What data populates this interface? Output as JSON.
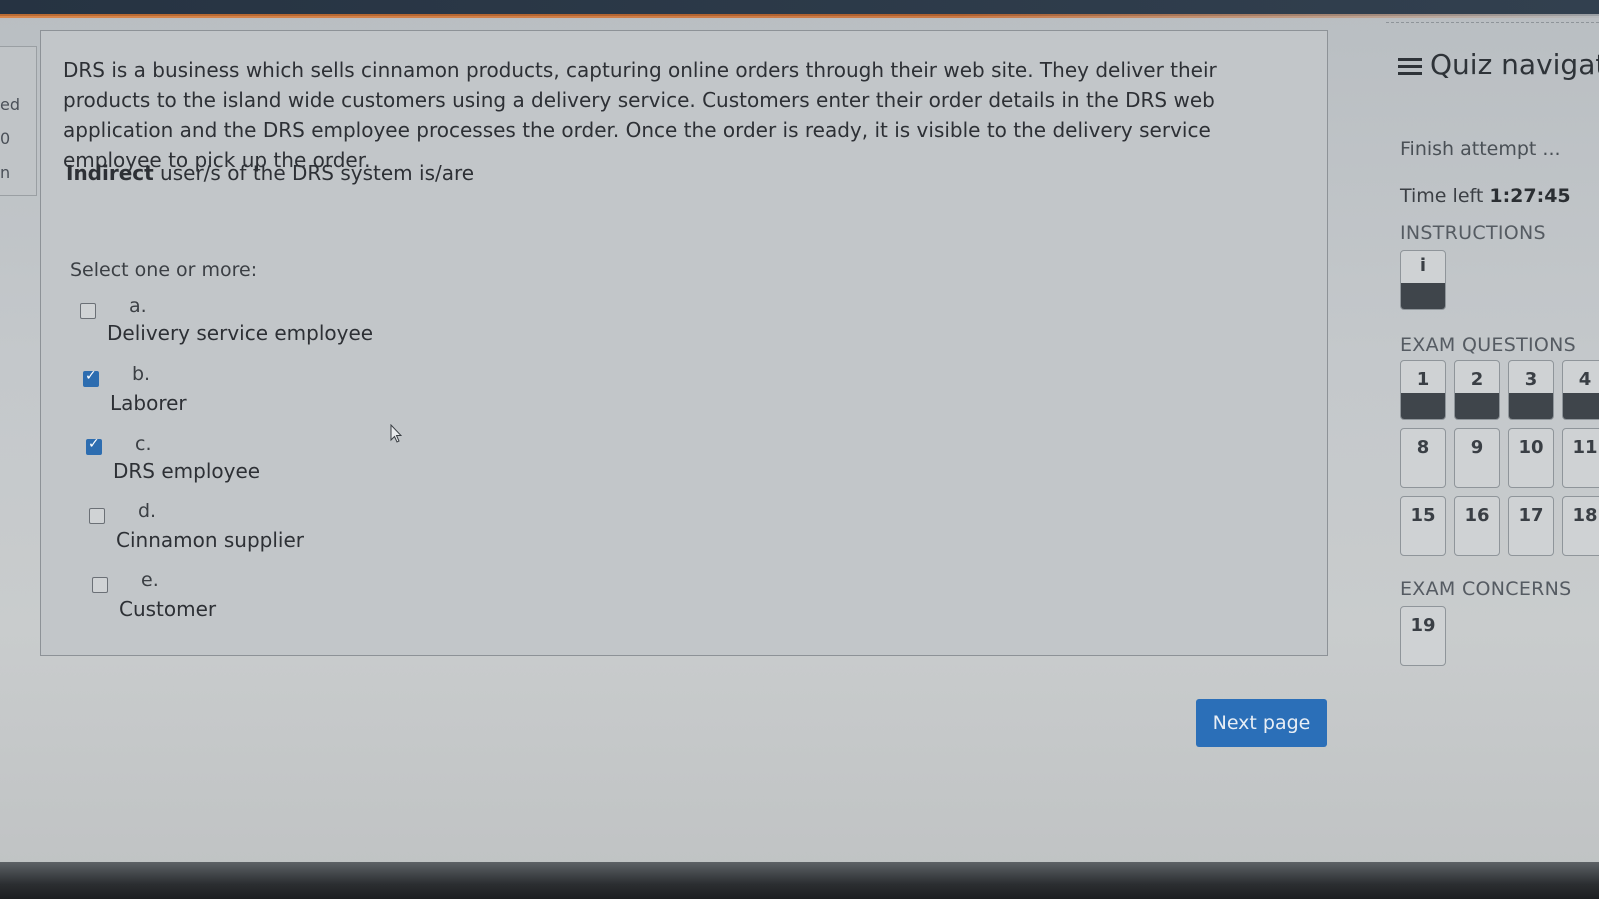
{
  "side_stub": {
    "lines": [
      "ed",
      "0",
      "n"
    ]
  },
  "question": {
    "text": "DRS is a business which sells cinnamon products, capturing online orders through their web site. They deliver their products to the island wide customers using a delivery service. Customers enter their order details in the DRS web application and the DRS employee processes the order. Once the order is ready, it is visible to the delivery service employee to pick up the order.",
    "prompt_bold": "Indirect",
    "prompt_rest": " user/s of the DRS system is/are",
    "select_label": "Select one or more:",
    "options": [
      {
        "letter": "a.",
        "text": "Delivery service employee",
        "checked": false
      },
      {
        "letter": "b.",
        "text": "Laborer",
        "checked": true
      },
      {
        "letter": "c.",
        "text": "DRS employee",
        "checked": true
      },
      {
        "letter": "d.",
        "text": "Cinnamon supplier",
        "checked": false
      },
      {
        "letter": "e.",
        "text": "Customer",
        "checked": false
      }
    ]
  },
  "next_button": {
    "label": "Next page"
  },
  "nav": {
    "title": "Quiz navigat",
    "finish": "Finish attempt ...",
    "time_label": "Time left ",
    "time_value": "1:27:45",
    "instructions_title": "INSTRUCTIONS",
    "instructions_btn": "i",
    "exam_questions_title": "EXAM QUESTIONS",
    "exam_questions": [
      "1",
      "2",
      "3",
      "4",
      "8",
      "9",
      "10",
      "11",
      "15",
      "16",
      "17",
      "18"
    ],
    "exam_concerns_title": "EXAM CONCERNS",
    "exam_concerns": [
      "19"
    ]
  }
}
